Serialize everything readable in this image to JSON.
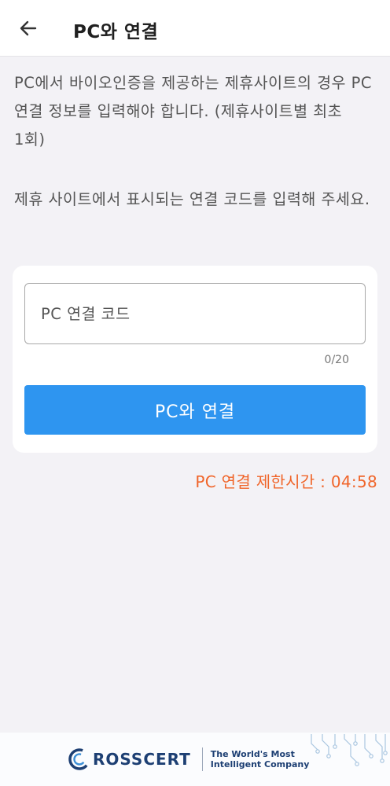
{
  "header": {
    "title": "PC와 연결"
  },
  "intro": {
    "line1": "PC에서 바이오인증을 제공하는 제휴사이트의 경우 PC 연결 정보를 입력해야 합니다. (제휴사이트별 최초 1회)",
    "line2": "제휴 사이트에서 표시되는 연결 코드를 입력해 주세요."
  },
  "form": {
    "code_placeholder": "PC 연결 코드",
    "code_value": "",
    "counter": "0/20",
    "connect_label": "PC와 연결"
  },
  "timer": {
    "text": "PC 연결 제한시간 : 04:58"
  },
  "footer": {
    "brand_first_letter": "C",
    "brand_rest": "ROSSCERT",
    "tagline_line1": "The World's Most",
    "tagline_line2": "Intelligent Company"
  },
  "colors": {
    "primary": "#2e95f0",
    "timer": "#f0652a",
    "brand": "#1d3f73"
  }
}
